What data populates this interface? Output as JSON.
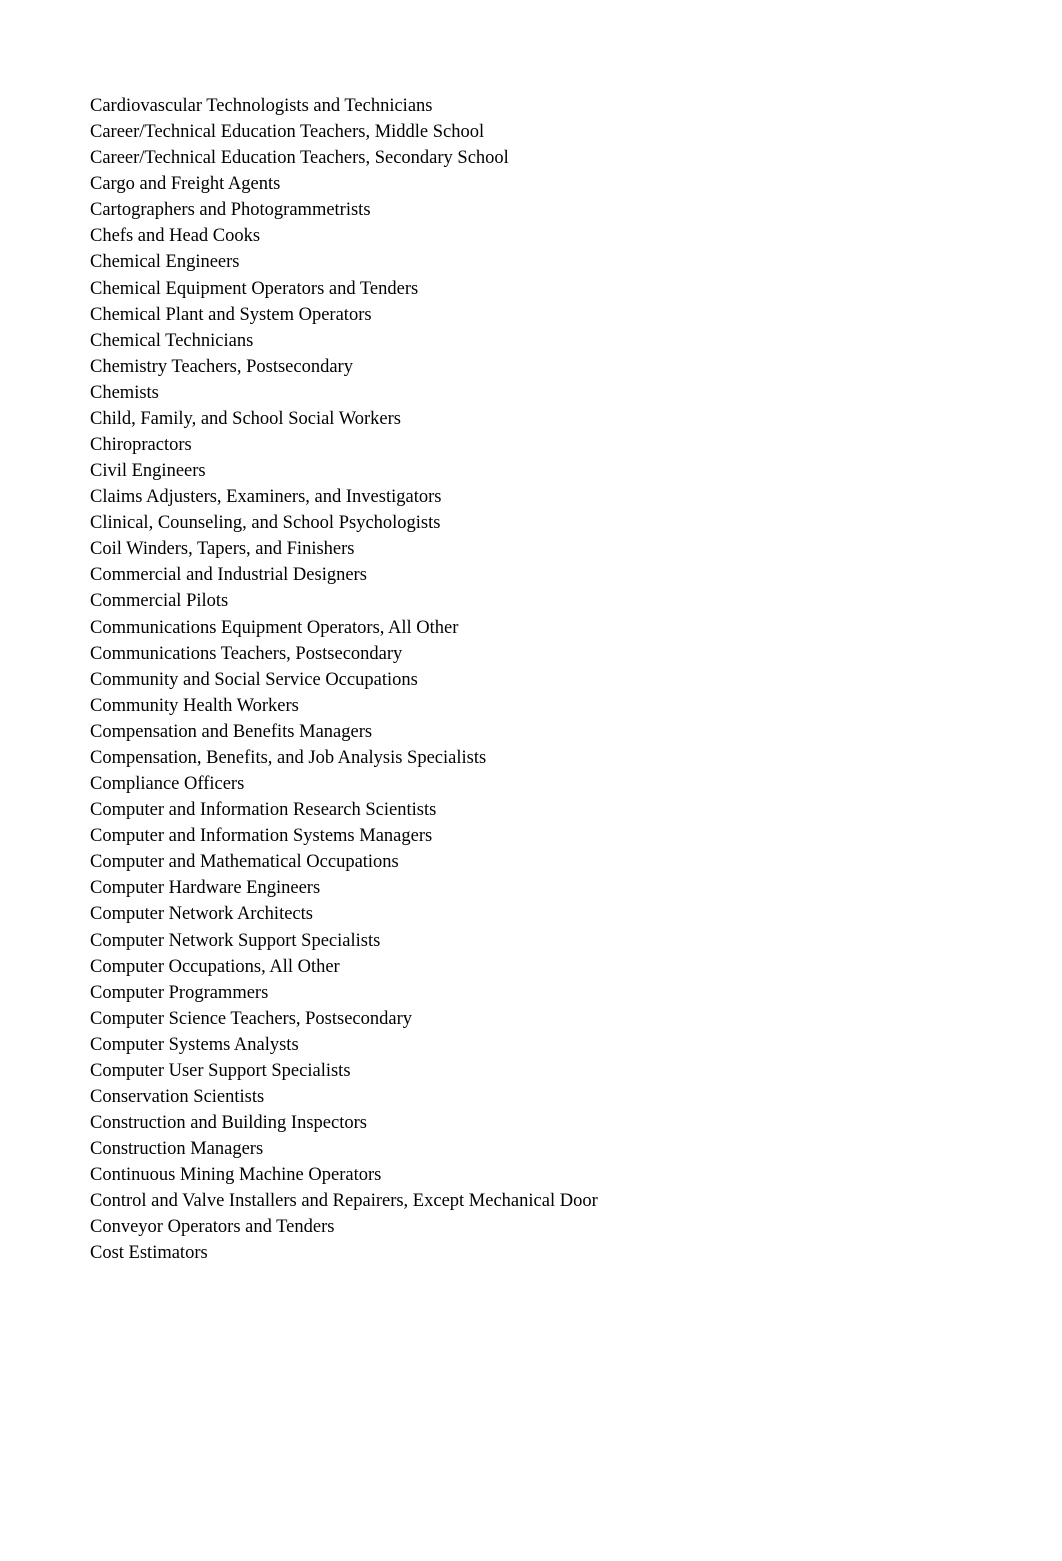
{
  "occupations": [
    "Cardiovascular Technologists and Technicians",
    "Career/Technical Education Teachers, Middle School",
    "Career/Technical Education Teachers, Secondary School",
    "Cargo and Freight Agents",
    "Cartographers and Photogrammetrists",
    "Chefs and Head Cooks",
    "Chemical Engineers",
    "Chemical Equipment Operators and Tenders",
    "Chemical Plant and System Operators",
    "Chemical Technicians",
    "Chemistry Teachers, Postsecondary",
    "Chemists",
    "Child, Family, and School Social Workers",
    "Chiropractors",
    "Civil Engineers",
    "Claims Adjusters, Examiners, and Investigators",
    "Clinical, Counseling, and School Psychologists",
    "Coil Winders, Tapers, and Finishers",
    "Commercial and Industrial Designers",
    "Commercial Pilots",
    "Communications Equipment Operators, All Other",
    "Communications Teachers, Postsecondary",
    "Community and Social Service Occupations",
    "Community Health Workers",
    "Compensation and Benefits Managers",
    "Compensation, Benefits, and Job Analysis Specialists",
    "Compliance Officers",
    "Computer and Information Research Scientists",
    "Computer and Information Systems Managers",
    "Computer and Mathematical Occupations",
    "Computer Hardware Engineers",
    "Computer Network Architects",
    "Computer Network Support Specialists",
    "Computer Occupations, All Other",
    "Computer Programmers",
    "Computer Science Teachers, Postsecondary",
    "Computer Systems Analysts",
    "Computer User Support Specialists",
    "Conservation Scientists",
    "Construction and Building Inspectors",
    "Construction Managers",
    "Continuous Mining Machine Operators",
    "Control and Valve Installers and Repairers, Except Mechanical Door",
    "Conveyor Operators and Tenders",
    "Cost Estimators"
  ]
}
